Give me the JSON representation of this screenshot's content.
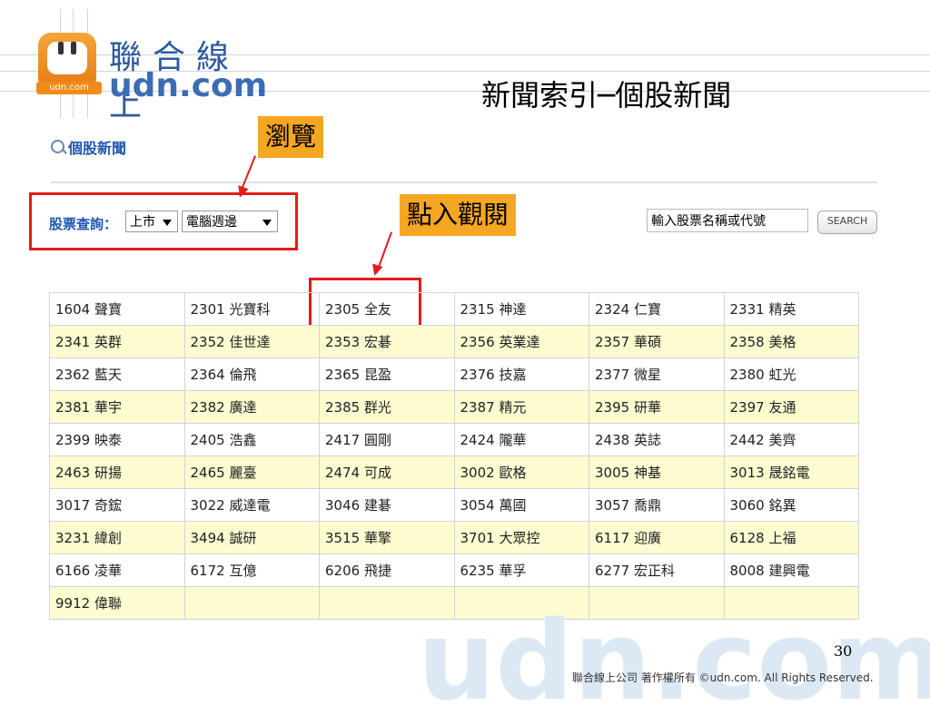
{
  "logo": {
    "cn": "聯合線上",
    "en": "udn.com",
    "badge": "udn.com"
  },
  "slide_title": "新聞索引─個股新聞",
  "breadcrumb": "個股新聞",
  "callouts": {
    "browse": "瀏覽",
    "click": "點入觀閱"
  },
  "search": {
    "label": "股票查詢：",
    "market_select": "上市",
    "category_select": "電腦週邊",
    "input_value": "輸入股票名稱或代號",
    "button": "SEARCH"
  },
  "table": {
    "rows": [
      [
        "1604 聲寶",
        "2301 光寶科",
        "2305 全友",
        "2315 神達",
        "2324 仁寶",
        "2331 精英"
      ],
      [
        "2341 英群",
        "2352 佳世達",
        "2353 宏碁",
        "2356 英業達",
        "2357 華碩",
        "2358 美格"
      ],
      [
        "2362 藍天",
        "2364 倫飛",
        "2365 昆盈",
        "2376 技嘉",
        "2377 微星",
        "2380 虹光"
      ],
      [
        "2381 華宇",
        "2382 廣達",
        "2385 群光",
        "2387 精元",
        "2395 研華",
        "2397 友通"
      ],
      [
        "2399 映泰",
        "2405 浩鑫",
        "2417 圓剛",
        "2424 隴華",
        "2438 英誌",
        "2442 美齊"
      ],
      [
        "2463 研揚",
        "2465 麗臺",
        "2474 可成",
        "3002 歐格",
        "3005 神基",
        "3013 晟銘電"
      ],
      [
        "3017 奇鋐",
        "3022 威達電",
        "3046 建碁",
        "3054 萬國",
        "3057 喬鼎",
        "3060 銘異"
      ],
      [
        "3231 緯創",
        "3494 誠研",
        "3515 華擎",
        "3701 大眾控",
        "6117 迎廣",
        "6128 上福"
      ],
      [
        "6166 凌華",
        "6172 互億",
        "6206 飛捷",
        "6235 華孚",
        "6277 宏正科",
        "8008 建興電"
      ],
      [
        "9912 偉聯",
        "",
        "",
        "",
        "",
        ""
      ]
    ]
  },
  "watermark": "udn.com",
  "page_number": "30",
  "footer": "聯合線上公司 著作權所有 ©udn.com. All Rights Reserved.",
  "colors": {
    "callout": "#f5a623",
    "highlight_box": "#e31b1b",
    "link": "#1f56b2",
    "alt_row": "#fdfbd0"
  }
}
